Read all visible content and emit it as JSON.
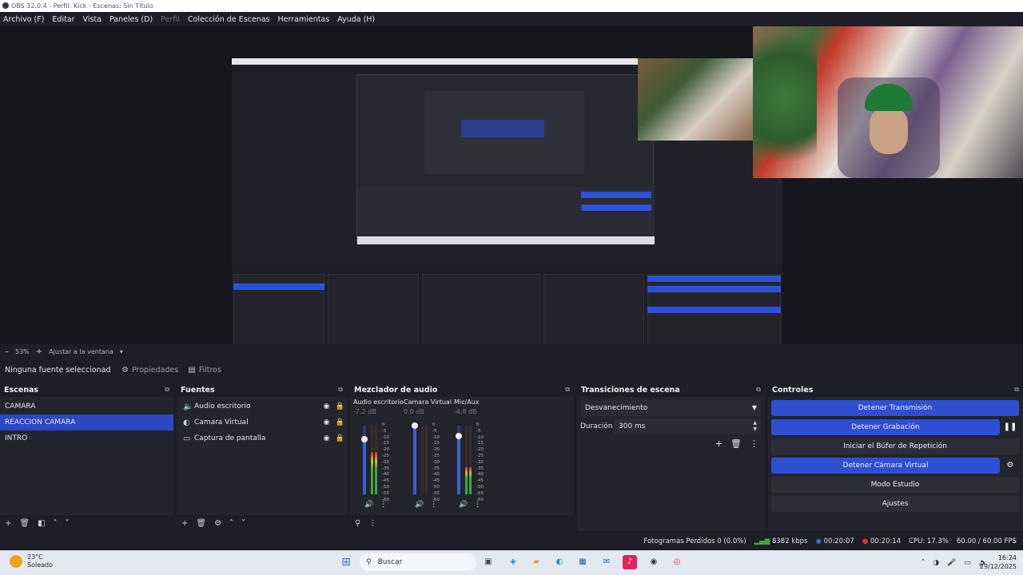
{
  "window": {
    "title": "OBS 32.0.4 - Perfil: Kick - Escenas: Sin Título"
  },
  "menu": [
    {
      "label": "Archivo (F)",
      "enabled": true
    },
    {
      "label": "Editar",
      "enabled": true
    },
    {
      "label": "Vista",
      "enabled": true
    },
    {
      "label": "Paneles (D)",
      "enabled": true
    },
    {
      "label": "Perfil",
      "enabled": false
    },
    {
      "label": "Colección de Escenas",
      "enabled": true
    },
    {
      "label": "Herramientas",
      "enabled": true
    },
    {
      "label": "Ayuda (H)",
      "enabled": true
    }
  ],
  "zoom": {
    "minus": "–",
    "percent": "53%",
    "plus": "+",
    "fit_label": "Ajustar a la ventana"
  },
  "source_toolbar": {
    "no_source": "Ninguna fuente seleccionad",
    "properties": "Propiedades",
    "filters": "Filtros"
  },
  "scenes": {
    "title": "Escenas",
    "items": [
      "CAMARA",
      "REACCION CAMARA",
      "INTRO"
    ],
    "selected": 1
  },
  "sources": {
    "title": "Fuentes",
    "items": [
      {
        "label": "Audio escritorio",
        "icon": "speaker-icon"
      },
      {
        "label": "Camara Virtual",
        "icon": "camera-icon"
      },
      {
        "label": "Captura de pantalla",
        "icon": "monitor-icon"
      }
    ]
  },
  "mixer": {
    "title": "Mezclador de audio",
    "channels": [
      {
        "name": "Audio escritorio",
        "db": "-7.2 dB",
        "volume": 0.8,
        "level": 0.62
      },
      {
        "name": "Camara Virtual",
        "db": "0.0 dB",
        "volume": 1.0,
        "level": 0.0
      },
      {
        "name": "Mic/Aux",
        "db": "-4.8 dB",
        "volume": 0.85,
        "level": 0.4
      }
    ],
    "ticks": [
      "0",
      "-5",
      "-10",
      "-15",
      "-20",
      "-25",
      "-30",
      "-35",
      "-40",
      "-45",
      "-50",
      "-55",
      "-60"
    ]
  },
  "transitions": {
    "title": "Transiciones de escena",
    "selected": "Desvanecimiento",
    "duration_label": "Duración",
    "duration_value": "300 ms"
  },
  "controls": {
    "title": "Controles",
    "buttons": [
      {
        "label": "Detener Transmisión",
        "active": true
      },
      {
        "label": "Detener Grabación",
        "active": true
      },
      {
        "label": "Iniciar el Búfer de Repetición",
        "active": false
      },
      {
        "label": "Detener Cámara Virtual",
        "active": true
      },
      {
        "label": "Modo Estudio",
        "active": false
      },
      {
        "label": "Ajustes",
        "active": false
      }
    ]
  },
  "status": {
    "dropped": "Fotogramas Perdidos 0 (0.0%)",
    "bitrate": "8382 kbps",
    "stream_time": "00:20:07",
    "rec_time": "00:20:14",
    "cpu": "CPU: 17.3%",
    "fps": "60.00 / 60.00 FPS"
  },
  "taskbar": {
    "weather_temp": "23°C",
    "weather_desc": "Soleado",
    "search_placeholder": "Buscar",
    "time": "16:24",
    "date": "29/12/2025"
  }
}
